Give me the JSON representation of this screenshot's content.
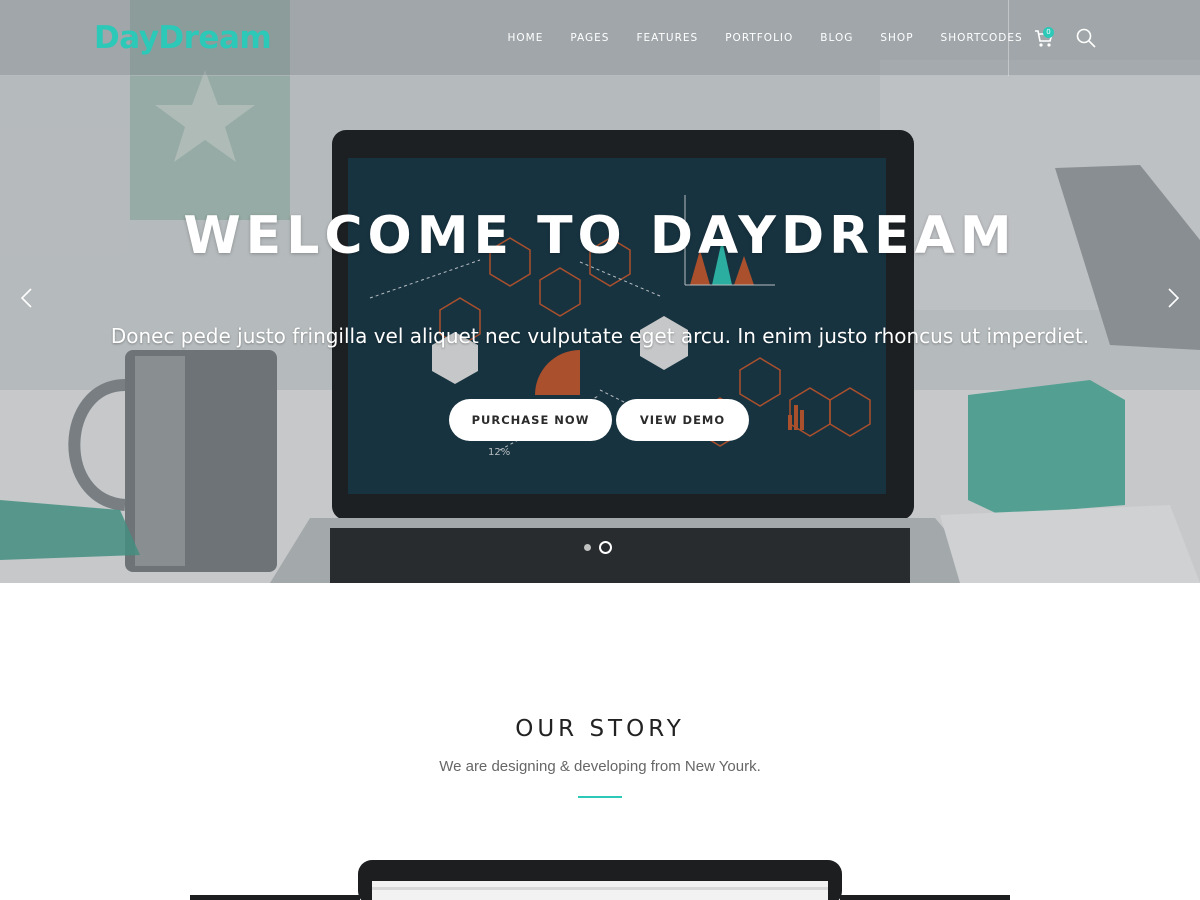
{
  "header": {
    "logo": "DayDream",
    "nav": [
      "HOME",
      "PAGES",
      "FEATURES",
      "PORTFOLIO",
      "BLOG",
      "SHOP",
      "SHORTCODES"
    ],
    "cart_count": "0",
    "icons": [
      "cart-icon",
      "search-icon"
    ]
  },
  "hero": {
    "title": "WELCOME TO DAYDREAM",
    "subtitle": "Donec pede justo fringilla vel aliquet nec vulputate eget arcu. In enim justo rhoncus ut imperdiet.",
    "purchase_label": "PURCHASE NOW",
    "demo_label": "VIEW DEMO",
    "slides_total": 2,
    "active_slide": 2,
    "screen_percent_label": "12%"
  },
  "story": {
    "title": "OUR STORY",
    "subtitle": "We are designing & developing from New Yourk."
  },
  "colors": {
    "accent": "#2cc8b8",
    "screen": "#123241",
    "orange": "#c9572a"
  }
}
